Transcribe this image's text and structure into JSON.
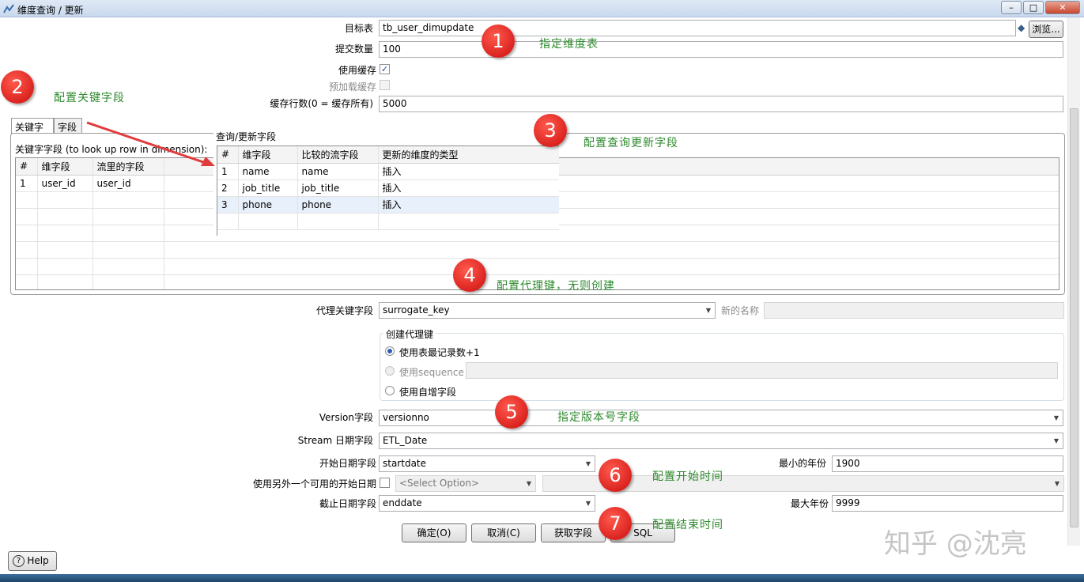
{
  "window": {
    "title": "维度查询 / 更新"
  },
  "fields": {
    "target_table": {
      "label": "目标表",
      "value": "tb_user_dimupdate",
      "browse": "浏览..."
    },
    "commit_size": {
      "label": "提交数量",
      "value": "100"
    },
    "use_cache": {
      "label": "使用缓存",
      "checked": true
    },
    "preload_cache": {
      "label": "预加载缓存",
      "checked": false
    },
    "cache_rows": {
      "label": "缓存行数(0 = 缓存所有)",
      "value": "5000"
    }
  },
  "tabs": [
    {
      "label": "关键字"
    },
    {
      "label": "字段"
    }
  ],
  "key_panel": {
    "label": "关键字字段 (to look up row in dimension):",
    "columns": [
      "#",
      "维字段",
      "流里的字段"
    ],
    "rows": [
      [
        "1",
        "user_id",
        "user_id"
      ]
    ]
  },
  "lookup_panel": {
    "label": "查询/更新字段",
    "columns": [
      "#",
      "维字段",
      "比较的流字段",
      "更新的维度的类型"
    ],
    "rows": [
      [
        "1",
        "name",
        "name",
        "插入"
      ],
      [
        "2",
        "job_title",
        "job_title",
        "插入"
      ],
      [
        "3",
        "phone",
        "phone",
        "插入"
      ]
    ]
  },
  "surrogate": {
    "label": "代理关键字段",
    "value": "surrogate_key",
    "new_name_label": "新的名称",
    "new_name_value": "",
    "group_title": "创建代理键",
    "options": [
      {
        "label": "使用表最记录数+1",
        "selected": true,
        "enabled": true
      },
      {
        "label": "使用sequence",
        "selected": false,
        "enabled": false
      },
      {
        "label": "使用自增字段",
        "selected": false,
        "enabled": true
      }
    ]
  },
  "version": {
    "label": "Version字段",
    "value": "versionno"
  },
  "stream_date": {
    "label": "Stream 日期字段",
    "value": "ETL_Date"
  },
  "start_date": {
    "label": "开始日期字段",
    "value": "startdate",
    "min_year_label": "最小的年份",
    "min_year": "1900"
  },
  "alt_start": {
    "label": "使用另外一个可用的开始日期",
    "checked": false,
    "select_placeholder": "<Select Option>"
  },
  "end_date": {
    "label": "截止日期字段",
    "value": "enddate",
    "max_year_label": "最大年份",
    "max_year": "9999"
  },
  "buttons": {
    "ok": "确定(O)",
    "cancel": "取消(C)",
    "get_fields": "获取字段",
    "sql": "SQL",
    "help": "Help"
  },
  "annotations": [
    {
      "num": "1",
      "text": "指定维度表"
    },
    {
      "num": "2",
      "text": "配置关键字段"
    },
    {
      "num": "3",
      "text": "配置查询更新字段"
    },
    {
      "num": "4",
      "text": "配置代理键，无则创建"
    },
    {
      "num": "5",
      "text": "指定版本号字段"
    },
    {
      "num": "6",
      "text": "配置开始时间"
    },
    {
      "num": "7",
      "text": "配置结束时间"
    }
  ],
  "watermark": "知乎 @沈亮",
  "colors": {
    "annotation_circle": "#d61414",
    "annotation_text": "#2d8a2d",
    "arrow": "#e03c3c"
  }
}
